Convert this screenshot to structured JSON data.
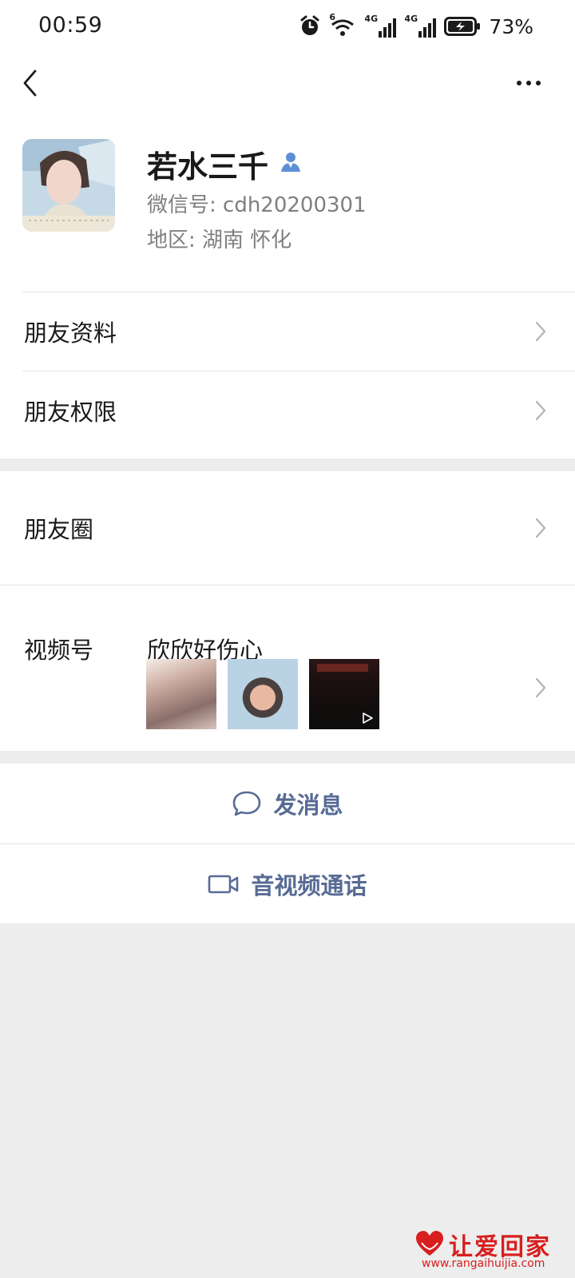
{
  "status_bar": {
    "time": "00:59",
    "battery_percent": "73%",
    "wifi_badge": "6",
    "network_1": "4G",
    "network_2": "4G",
    "icons": [
      "alarm-icon",
      "wifi-icon",
      "signal-icon",
      "signal-icon",
      "battery-charging-icon"
    ]
  },
  "nav": {
    "back_icon": "chevron-left-icon",
    "more_icon": "more-dots-icon"
  },
  "profile": {
    "name": "若水三千",
    "wechat_id": "微信号: cdh20200301",
    "region": "地区: 湖南  怀化",
    "friend_icon": "person-icon"
  },
  "rows": {
    "friend_info": "朋友资料",
    "friend_permissions": "朋友权限",
    "moments": "朋友圈",
    "channels": "视频号",
    "channels_name": "欣欣好伤心"
  },
  "actions": {
    "message": "发消息",
    "call": "音视频通话"
  },
  "watermark": {
    "title": "让爱回家",
    "url": "www.rangaihuijia.com"
  },
  "colors": {
    "background": "#ededed",
    "card": "#ffffff",
    "link_blue": "#576b95",
    "secondary_text": "#7f7f7f",
    "watermark_red": "#d81e1e"
  }
}
